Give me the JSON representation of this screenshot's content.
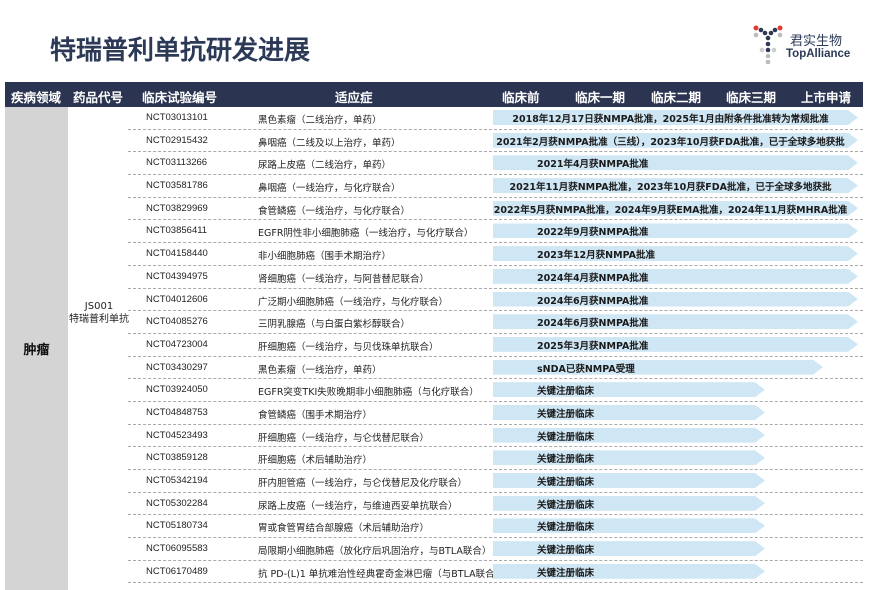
{
  "title": "特瑞普利单抗研发进展",
  "logo": {
    "cn": "君实生物",
    "en": "TopAlliance"
  },
  "header": [
    "疾病领域",
    "药品代号",
    "临床试验编号",
    "适应症",
    "临床前",
    "临床一期",
    "临床二期",
    "临床三期",
    "上市申请"
  ],
  "disease": "肿瘤",
  "drug": {
    "code": "JS001",
    "name": "特瑞普利单抗"
  },
  "colors": {
    "header": "#2b3450",
    "bar": "#cfe6f4",
    "title": "#2c3a58"
  },
  "rows": [
    {
      "nct": "NCT03013101",
      "indication": "黑色素瘤（二线治疗，单药）",
      "status": "2018年12月17日获NMPA批准，2025年1月由附条件批准转为常规批准",
      "stage": "上市申请"
    },
    {
      "nct": "NCT02915432",
      "indication": "鼻咽癌（二线及以上治疗，单药）",
      "status": "2021年2月获NMPA批准（三线），2023年10月获FDA批准，已于全球多地获批",
      "stage": "上市申请"
    },
    {
      "nct": "NCT03113266",
      "indication": "尿路上皮癌（二线治疗，单药）",
      "status": "2021年4月获NMPA批准",
      "stage": "上市申请"
    },
    {
      "nct": "NCT03581786",
      "indication": "鼻咽癌（一线治疗，与化疗联合）",
      "status": "2021年11月获NMPA批准，2023年10月获FDA批准，已于全球多地获批",
      "stage": "上市申请"
    },
    {
      "nct": "NCT03829969",
      "indication": "食管鳞癌（一线治疗，与化疗联合）",
      "status": "2022年5月获NMPA批准，2024年9月获EMA批准，2024年11月获MHRA批准",
      "stage": "上市申请"
    },
    {
      "nct": "NCT03856411",
      "indication": "EGFR阴性非小细胞肺癌（一线治疗，与化疗联合）",
      "status": "2022年9月获NMPA批准",
      "stage": "上市申请"
    },
    {
      "nct": "NCT04158440",
      "indication": "非小细胞肺癌（围手术期治疗）",
      "status": "2023年12月获NMPA批准",
      "stage": "上市申请"
    },
    {
      "nct": "NCT04394975",
      "indication": "肾细胞癌（一线治疗，与阿昔替尼联合）",
      "status": "2024年4月获NMPA批准",
      "stage": "上市申请"
    },
    {
      "nct": "NCT04012606",
      "indication": "广泛期小细胞肺癌（一线治疗，与化疗联合）",
      "status": "2024年6月获NMPA批准",
      "stage": "上市申请"
    },
    {
      "nct": "NCT04085276",
      "indication": "三阴乳腺癌（与白蛋白紫杉醇联合）",
      "status": "2024年6月获NMPA批准",
      "stage": "上市申请"
    },
    {
      "nct": "NCT04723004",
      "indication": "肝细胞癌（一线治疗，与贝伐珠单抗联合）",
      "status": "2025年3月获NMPA批准",
      "stage": "上市申请"
    },
    {
      "nct": "NCT03430297",
      "indication": "黑色素瘤（一线治疗，单药）",
      "status": "sNDA已获NMPA受理",
      "stage": "上市申请受理"
    },
    {
      "nct": "NCT03924050",
      "indication": "EGFR突变TKI失败晚期非小细胞肺癌（与化疗联合）",
      "status": "关键注册临床",
      "stage": "临床三期"
    },
    {
      "nct": "NCT04848753",
      "indication": "食管鳞癌（围手术期治疗）",
      "status": "关键注册临床",
      "stage": "临床三期"
    },
    {
      "nct": "NCT04523493",
      "indication": "肝细胞癌（一线治疗，与仑伐替尼联合）",
      "status": "关键注册临床",
      "stage": "临床三期"
    },
    {
      "nct": "NCT03859128",
      "indication": "肝细胞癌（术后辅助治疗）",
      "status": "关键注册临床",
      "stage": "临床三期"
    },
    {
      "nct": "NCT05342194",
      "indication": "肝内胆管癌（一线治疗，与仑伐替尼及化疗联合）",
      "status": "关键注册临床",
      "stage": "临床三期"
    },
    {
      "nct": "NCT05302284",
      "indication": "尿路上皮癌（一线治疗，与维迪西妥单抗联合）",
      "status": "关键注册临床",
      "stage": "临床三期"
    },
    {
      "nct": "NCT05180734",
      "indication": "胃或食管胃结合部腺癌（术后辅助治疗）",
      "status": "关键注册临床",
      "stage": "临床三期"
    },
    {
      "nct": "NCT06095583",
      "indication": "局限期小细胞肺癌（放化疗后巩固治疗，与BTLA联合）",
      "status": "关键注册临床",
      "stage": "临床三期"
    },
    {
      "nct": "NCT06170489",
      "indication": "抗 PD-(L)1 单抗难治性经典霍奇金淋巴瘤（与BTLA联合）",
      "status": "关键注册临床",
      "stage": "临床三期"
    }
  ]
}
